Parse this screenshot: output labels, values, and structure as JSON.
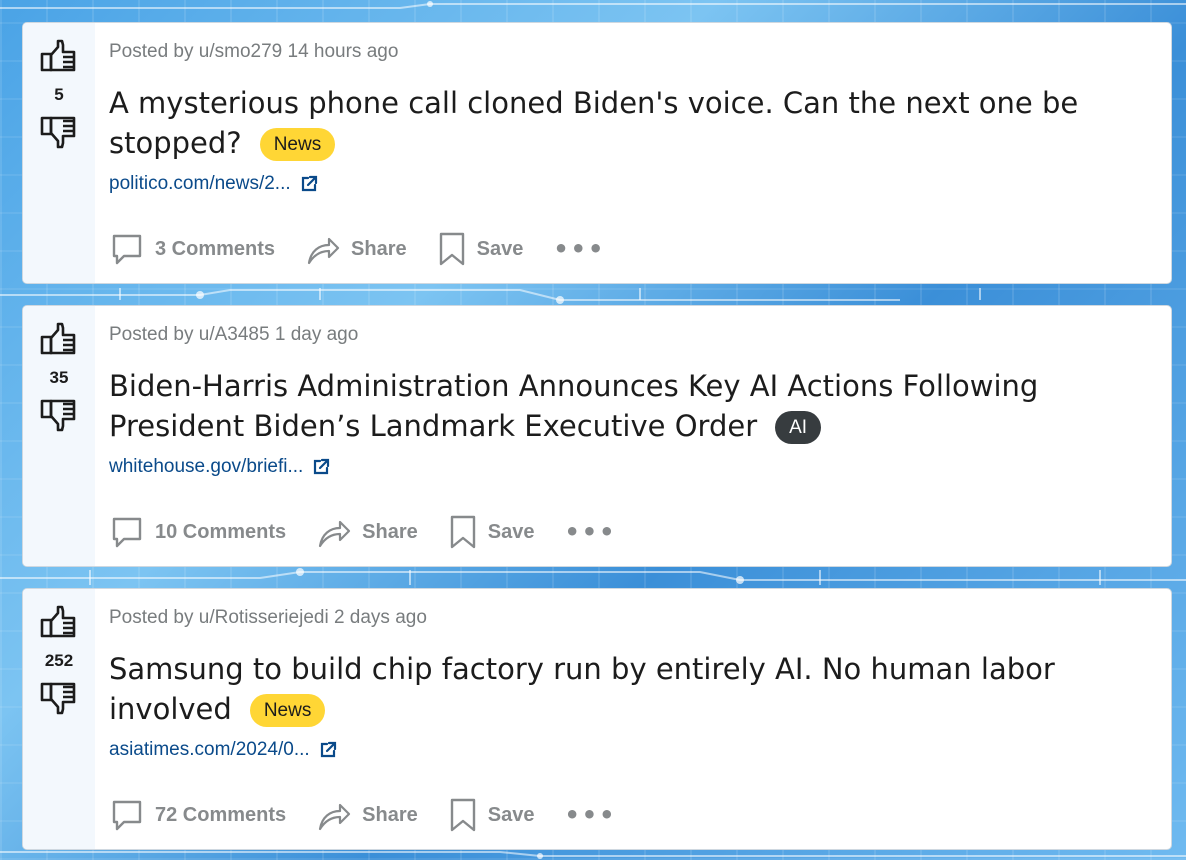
{
  "posts": [
    {
      "score": "5",
      "meta": "Posted by u/smo279 14 hours ago",
      "title": "A mysterious phone call cloned Biden's voice. Can the next one be stopped?",
      "flair": "News",
      "flair_style": "news",
      "link": "politico.com/news/2...",
      "comments": "3 Comments",
      "share": "Share",
      "save": "Save"
    },
    {
      "score": "35",
      "meta": "Posted by u/A3485 1 day ago",
      "title": "Biden-Harris Administration Announces Key AI Actions Following President Biden’s Landmark Executive Order",
      "flair": "AI",
      "flair_style": "ai",
      "link": "whitehouse.gov/briefi...",
      "comments": "10 Comments",
      "share": "Share",
      "save": "Save"
    },
    {
      "score": "252",
      "meta": "Posted by u/Rotisseriejedi 2 days ago",
      "title": "Samsung to build chip factory run by entirely AI. No human labor involved",
      "flair": "News",
      "flair_style": "news",
      "link": "asiatimes.com/2024/0...",
      "comments": "72 Comments",
      "share": "Share",
      "save": "Save"
    }
  ],
  "icons": {
    "upvote": "thumbs-up-icon",
    "downvote": "thumbs-down-icon",
    "external": "external-link-icon",
    "comment": "comment-icon",
    "share": "share-arrow-icon",
    "save": "bookmark-icon",
    "more": "more-dots-icon"
  },
  "colors": {
    "news_flair": "#ffd635",
    "ai_flair": "#373c3f",
    "link": "#0a4a8a",
    "muted": "#878a8c"
  }
}
